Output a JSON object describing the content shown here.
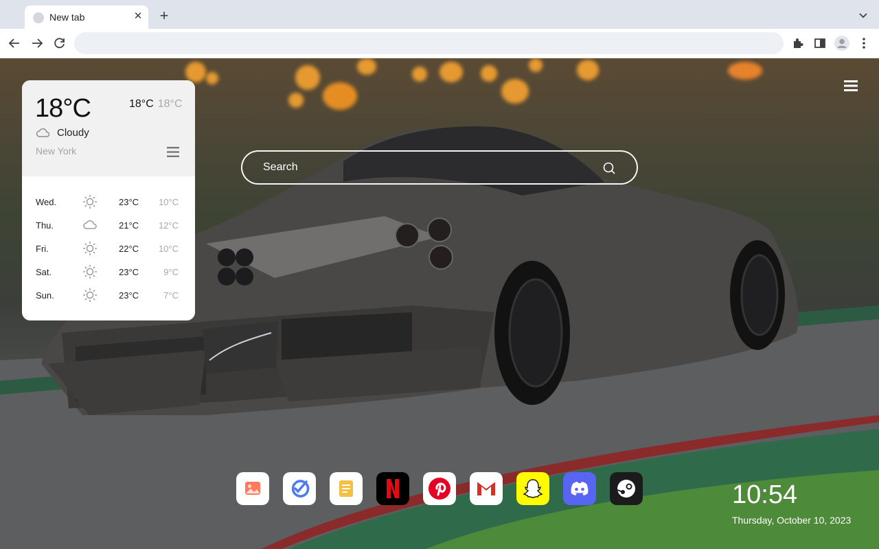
{
  "browser": {
    "tab": {
      "title": "New tab"
    },
    "omnibox": {
      "value": ""
    }
  },
  "weather": {
    "current": {
      "temp": "18°C",
      "high": "18°C",
      "low": "18°C",
      "condition": "Cloudy",
      "condition_icon": "cloud-icon"
    },
    "city": "New York",
    "forecast": [
      {
        "day": "Wed.",
        "icon": "sun-icon",
        "high": "23°C",
        "low": "10°C"
      },
      {
        "day": "Thu.",
        "icon": "cloud-icon",
        "high": "21°C",
        "low": "12°C"
      },
      {
        "day": "Fri.",
        "icon": "sun-icon",
        "high": "22°C",
        "low": "10°C"
      },
      {
        "day": "Sat.",
        "icon": "sun-icon",
        "high": "23°C",
        "low": "9°C"
      },
      {
        "day": "Sun.",
        "icon": "sun-icon",
        "high": "23°C",
        "low": "7°C"
      }
    ]
  },
  "search": {
    "placeholder": "Search"
  },
  "dock": [
    {
      "name": "photos",
      "icon": "photos-icon",
      "color": "#ffffff"
    },
    {
      "name": "tasks",
      "icon": "tasks-icon",
      "color": "#ffffff"
    },
    {
      "name": "notes",
      "icon": "notes-icon",
      "color": "#ffffff"
    },
    {
      "name": "netflix",
      "icon": "netflix-icon",
      "color": "#000000"
    },
    {
      "name": "pinterest",
      "icon": "pinterest-icon",
      "color": "#ffffff"
    },
    {
      "name": "gmail",
      "icon": "gmail-icon",
      "color": "#ffffff"
    },
    {
      "name": "snapchat",
      "icon": "snapchat-icon",
      "color": "#fffc00"
    },
    {
      "name": "discord",
      "icon": "discord-icon",
      "color": "#5865f2"
    },
    {
      "name": "steam",
      "icon": "steam-icon",
      "color": "#1b1b1b"
    }
  ],
  "clock": {
    "time": "10:54",
    "date": "Thursday, October 10, 2023"
  }
}
